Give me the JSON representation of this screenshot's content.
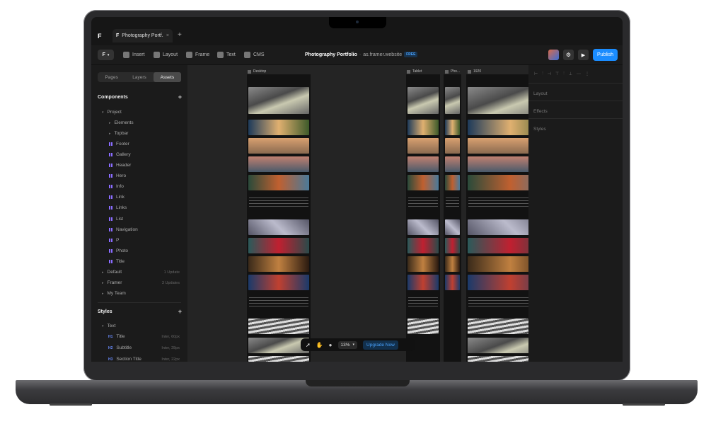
{
  "window": {
    "tab_title": "Photography Portf."
  },
  "toolbar": {
    "insert": "Insert",
    "layout": "Layout",
    "frame": "Frame",
    "text": "Text",
    "cms": "CMS",
    "project_title": "Photography Portfolio",
    "site_url": "as.framer.website",
    "plan_badge": "FREE",
    "publish": "Publish"
  },
  "left_panel": {
    "tabs": [
      "Pages",
      "Layers",
      "Assets"
    ],
    "components_header": "Components",
    "project_label": "Project",
    "items": [
      "Elements",
      "Topbar",
      "Footer",
      "Gallery",
      "Header",
      "Hero",
      "Info",
      "Link",
      "Links",
      "List",
      "Navigation",
      "P",
      "Photo",
      "Title"
    ],
    "groups": [
      {
        "name": "Default",
        "meta": "1 Update"
      },
      {
        "name": "Framer",
        "meta": "3 Updates"
      },
      {
        "name": "My Team",
        "meta": ""
      }
    ],
    "styles_header": "Styles",
    "text_label": "Text",
    "text_styles": [
      {
        "tag": "H1",
        "name": "Title",
        "meta": "Inter, 60px"
      },
      {
        "tag": "H2",
        "name": "Subtitle",
        "meta": "Inter, 28px"
      },
      {
        "tag": "H3",
        "name": "Section Title",
        "meta": "Inter, 22px"
      }
    ]
  },
  "canvas": {
    "frames": [
      "Desktop",
      "Tablet",
      "Pho...",
      "1920"
    ],
    "zoom": "13%",
    "upgrade": "Upgrade Now"
  },
  "right_panel": {
    "labels": [
      "Layout",
      "Effects",
      "Styles"
    ]
  },
  "colors": {
    "accent": "#1a8cff",
    "component_icon": "#8a6cff"
  }
}
